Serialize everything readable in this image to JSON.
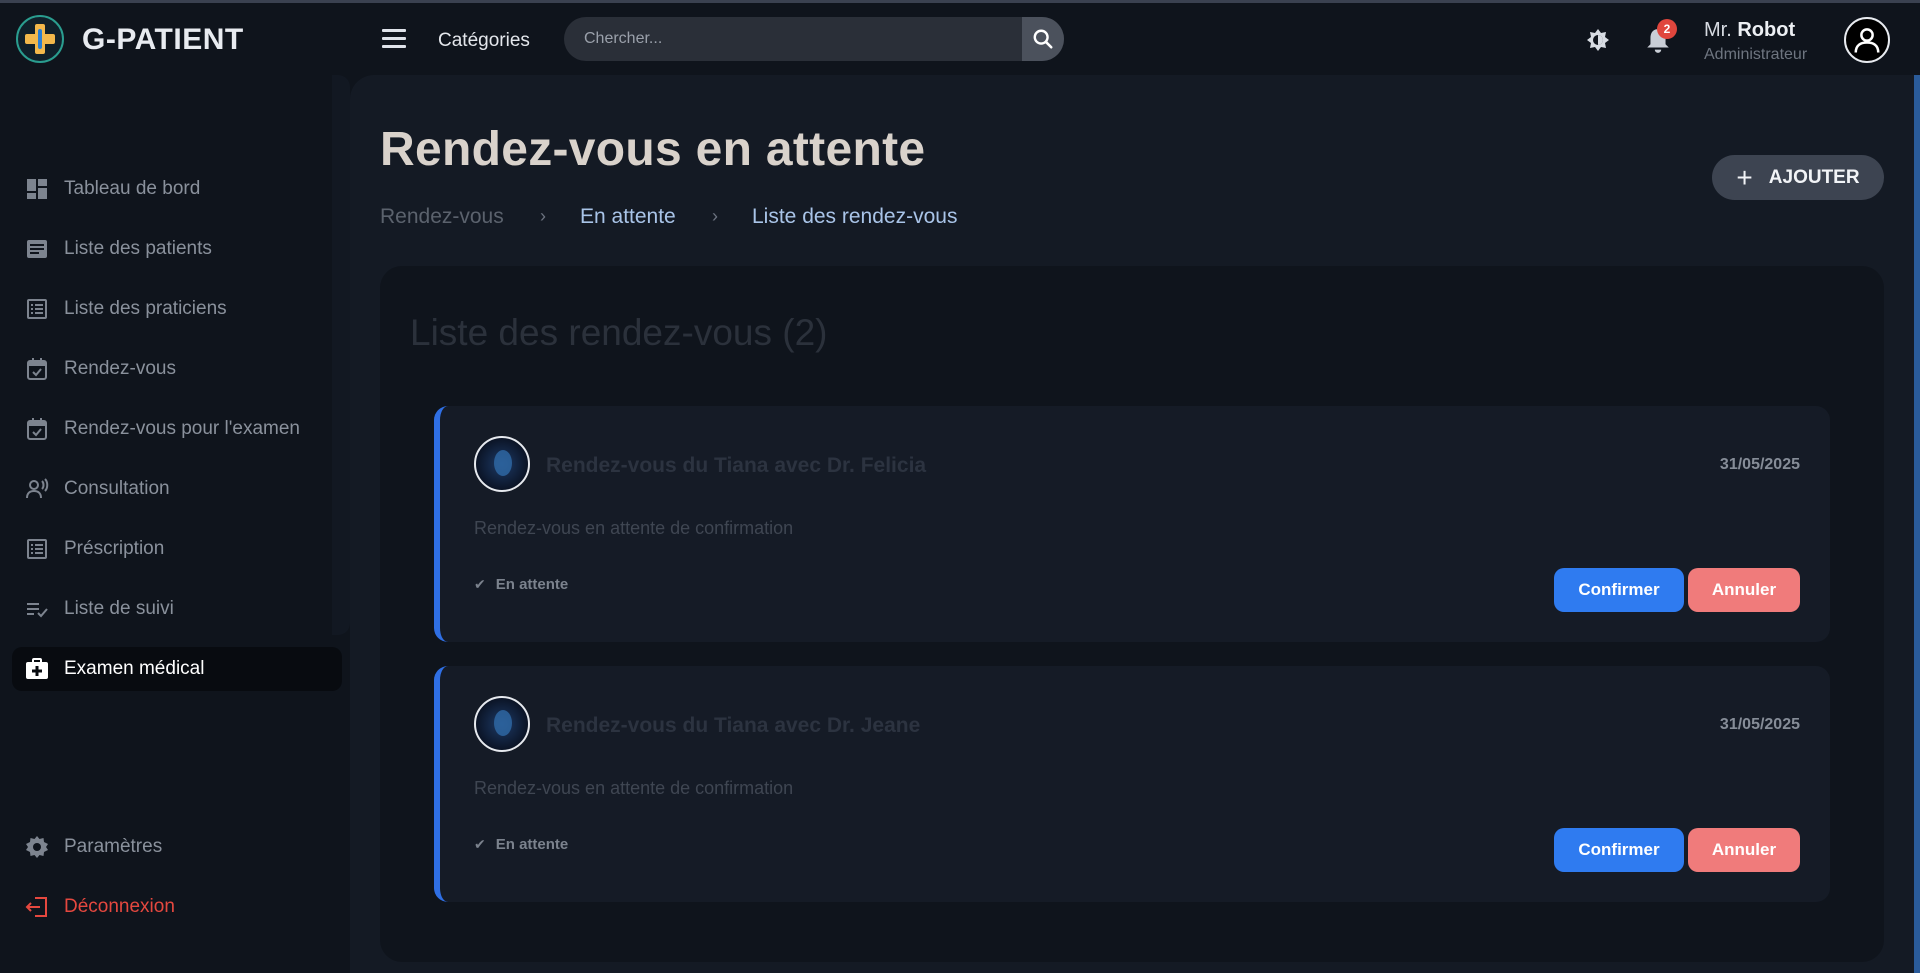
{
  "header": {
    "brand": "G-PATIENT",
    "categories_label": "Catégories",
    "search_placeholder": "Chercher...",
    "notification_count": "2",
    "user_prefix": "Mr.",
    "user_name": "Robot",
    "user_role": "Administrateur"
  },
  "sidebar": {
    "items": [
      {
        "label": "Tableau de bord",
        "icon": "dashboard-icon"
      },
      {
        "label": "Liste des patients",
        "icon": "list-icon"
      },
      {
        "label": "Liste des praticiens",
        "icon": "list-alt-icon"
      },
      {
        "label": "Rendez-vous",
        "icon": "calendar-check-icon"
      },
      {
        "label": "Rendez-vous pour l'examen",
        "icon": "calendar-check-icon"
      },
      {
        "label": "Consultation",
        "icon": "voice-user-icon"
      },
      {
        "label": "Préscription",
        "icon": "list-alt-icon"
      },
      {
        "label": "Liste de suivi",
        "icon": "checklist-icon"
      },
      {
        "label": "Examen médical",
        "icon": "medical-kit-icon"
      }
    ],
    "settings_label": "Paramètres",
    "logout_label": "Déconnexion"
  },
  "main": {
    "title": "Rendez-vous en attente",
    "breadcrumb": [
      "Rendez-vous",
      "En attente",
      "Liste des rendez-vous"
    ],
    "add_label": "AJOUTER",
    "list_title": "Liste des rendez-vous (2)",
    "appointments": [
      {
        "title": "Rendez-vous du Tiana avec Dr. Felicia",
        "date": "31/05/2025",
        "description": "Rendez-vous en attente de confirmation",
        "status": "En attente",
        "confirm_label": "Confirmer",
        "cancel_label": "Annuler"
      },
      {
        "title": "Rendez-vous du Tiana avec Dr. Jeane",
        "date": "31/05/2025",
        "description": "Rendez-vous en attente de confirmation",
        "status": "En attente",
        "confirm_label": "Confirmer",
        "cancel_label": "Annuler"
      }
    ]
  },
  "colors": {
    "background": "#0f141c",
    "accent_blue": "#2f7bf0",
    "cancel_red": "#f07b7b",
    "logout_red": "#e5483f",
    "badge_red": "#e0463d"
  }
}
